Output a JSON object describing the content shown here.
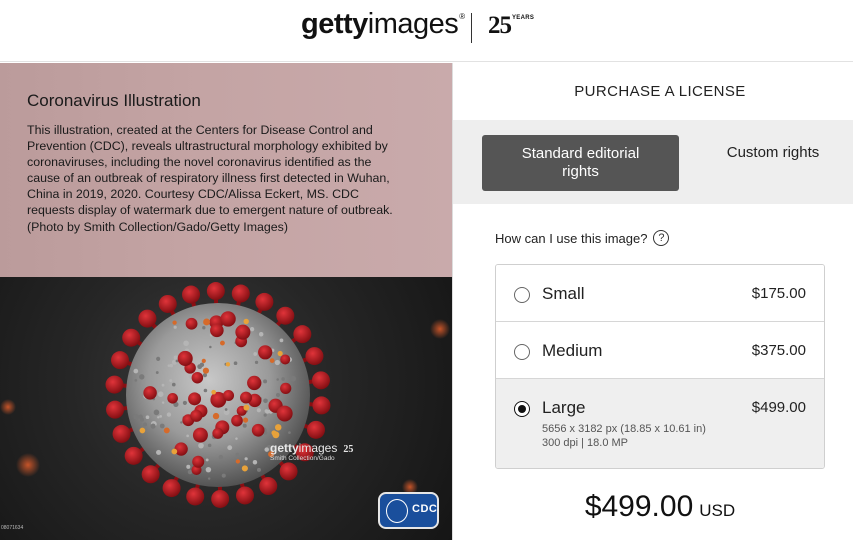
{
  "header": {
    "brand_bold": "getty",
    "brand_regular": "images",
    "brand_mark": "®",
    "anniversary_number": "25",
    "anniversary_label": "YEARS"
  },
  "image_info": {
    "title": "Coronavirus Illustration",
    "description": "This illustration, created at the Centers for Disease Control and Prevention (CDC), reveals ultrastructural morphology exhibited by coronaviruses, including the novel coronavirus identified as the cause of an outbreak of respiratory illness first detected in Wuhan, China in 2019, 2020. Courtesy CDC/Alissa Eckert, MS. CDC requests display of watermark due to emergent nature of outbreak. (Photo by Smith Collection/Gado/Getty Images)"
  },
  "image": {
    "watermark_bold": "getty",
    "watermark_regular": "images",
    "watermark_years": "25",
    "watermark_credit": "Smith Collection/Gado",
    "image_id": "08071634",
    "badge_text": "CDC"
  },
  "license": {
    "title": "PURCHASE A LICENSE",
    "tabs": [
      {
        "label": "Standard editorial rights",
        "active": true
      },
      {
        "label": "Custom rights",
        "active": false
      }
    ],
    "usage_question": "How can I use this image?",
    "help_icon_glyph": "?",
    "options": [
      {
        "name": "Small",
        "price": "$175.00",
        "selected": false
      },
      {
        "name": "Medium",
        "price": "$375.00",
        "selected": false
      },
      {
        "name": "Large",
        "price": "$499.00",
        "selected": true,
        "detail_line1": "5656 x 3182 px (18.85 x 10.61 in)",
        "detail_line2": "300 dpi | 18.0 MP"
      }
    ],
    "total_amount": "$499.00",
    "total_currency": "USD"
  },
  "colors": {
    "active_tab": "#555555",
    "tabs_background": "#eeeeee",
    "description_panel": "#c4a4a4",
    "virus_body": "#9a9a9a",
    "virus_spike": "#b3181e",
    "cdc_badge": "#1a4f9c"
  },
  "icons": {
    "help": "question-circle-icon",
    "radio_selected": "radio-selected-icon",
    "radio_unselected": "radio-unselected-icon"
  }
}
